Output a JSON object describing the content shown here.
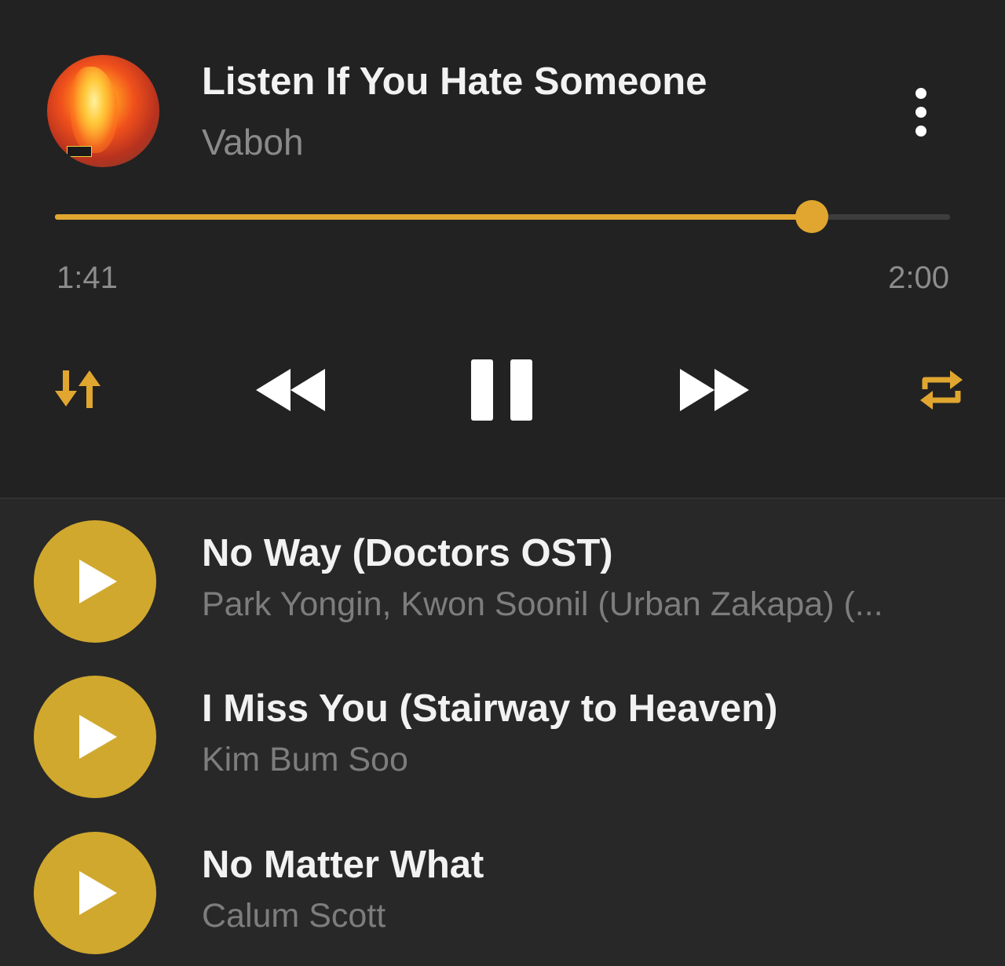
{
  "now_playing": {
    "title": "Listen If You Hate Someone",
    "artist": "Vaboh",
    "album_art_text": "ANGRY",
    "elapsed": "1:41",
    "duration": "2:00",
    "progress_fraction": 0.846
  },
  "controls": {
    "shuffle_icon": "sort-arrows-icon",
    "previous_icon": "rewind-icon",
    "play_pause_icon": "pause-icon",
    "next_icon": "fast-forward-icon",
    "repeat_icon": "repeat-icon",
    "more_icon": "more-vertical-icon"
  },
  "colors": {
    "accent": "#e0a630",
    "play_button": "#d0a82e",
    "background": "#222222",
    "list_background": "#282828"
  },
  "queue": [
    {
      "title": "No Way (Doctors OST)",
      "artist": "Park Yongin, Kwon Soonil (Urban Zakapa) (..."
    },
    {
      "title": "I Miss You (Stairway to Heaven)",
      "artist": "Kim Bum Soo"
    },
    {
      "title": "No Matter What",
      "artist": "Calum Scott"
    }
  ]
}
